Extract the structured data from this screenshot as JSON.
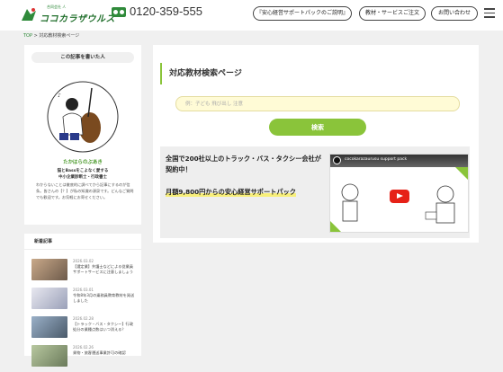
{
  "header": {
    "logo_sub": "合同会社 人",
    "logo_name": "ココカラザウルス",
    "phone": "0120-359-555",
    "btn_support": "『安心経営サポートパックのご説明』",
    "btn_materials": "教材・サービスご注文",
    "btn_contact": "お問い合わせ"
  },
  "breadcrumb": {
    "top": "TOP",
    "sep": " > ",
    "current": "対応教材検索ページ"
  },
  "author": {
    "heading": "この記事を書いた人",
    "name": "たかはらのぶあき",
    "tag1": "猫とBassをこよなく愛する",
    "tag2": "中小企業診断士・行政書士",
    "desc": "わからないことは徹底的に調べてから記事にするのが信条。皆さんの【？】が私の知識の源泉です。どんなご質問でも歓迎です。お気軽にお寄せください。"
  },
  "recent": {
    "heading": "新着記事",
    "items": [
      {
        "date": "2026.03.02",
        "title": "【選定業】弁護士などによる従業員サポートサービスに注意しましょう"
      },
      {
        "date": "2026.03.01",
        "title": "令和8年3月の乗務員教育教材を発送しました"
      },
      {
        "date": "2026.02.28",
        "title": "【トラック・バス・タクシー】行政処分の業種点数はいつ消える？"
      },
      {
        "date": "2026.02.26",
        "title": "貨物・旅客運送事業許可の確認"
      }
    ]
  },
  "main": {
    "title": "対応教材検索ページ",
    "search_placeholder": "例：子ども 飛び出し 注意",
    "search_button": "検索",
    "banner_line1": "全国で200社以上のトラック・バス・タクシー会社が契約中！",
    "banner_line2": "月額9,800円からの安心経営サポートパック",
    "video_title": "cocokarazaurusu support pack"
  },
  "colors": {
    "brand_green": "#2f8a3a",
    "accent_green": "#8ac43a",
    "youtube_red": "#e62117"
  }
}
